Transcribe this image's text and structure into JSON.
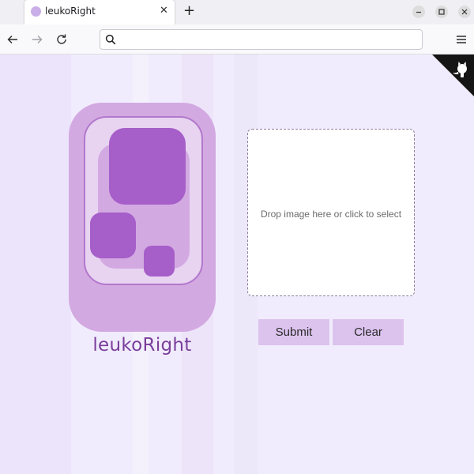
{
  "browser": {
    "tab": {
      "title": "leukoRight",
      "favicon": "app-favicon",
      "close_icon": "close-icon"
    },
    "new_tab_icon": "plus-icon",
    "window_controls": [
      "minimize-icon",
      "maximize-icon",
      "close-icon"
    ],
    "nav": {
      "back": "arrow-left-icon",
      "forward": "arrow-right-icon",
      "reload": "reload-icon",
      "menu": "hamburger-menu-icon"
    },
    "address_bar": {
      "value": "",
      "placeholder": ""
    }
  },
  "page": {
    "background": "#f1ecfd",
    "corner_ribbon_icon": "github-octocat-icon",
    "logo": {
      "text": "leukoRight"
    },
    "upload": {
      "prompt": "Drop image here or click to select"
    },
    "buttons": {
      "submit": "Submit",
      "clear": "Clear"
    },
    "colors": {
      "accent": "#dcc3ee",
      "logo_purple": "#a65ec9",
      "logo_bg": "#d3a9e2"
    }
  }
}
